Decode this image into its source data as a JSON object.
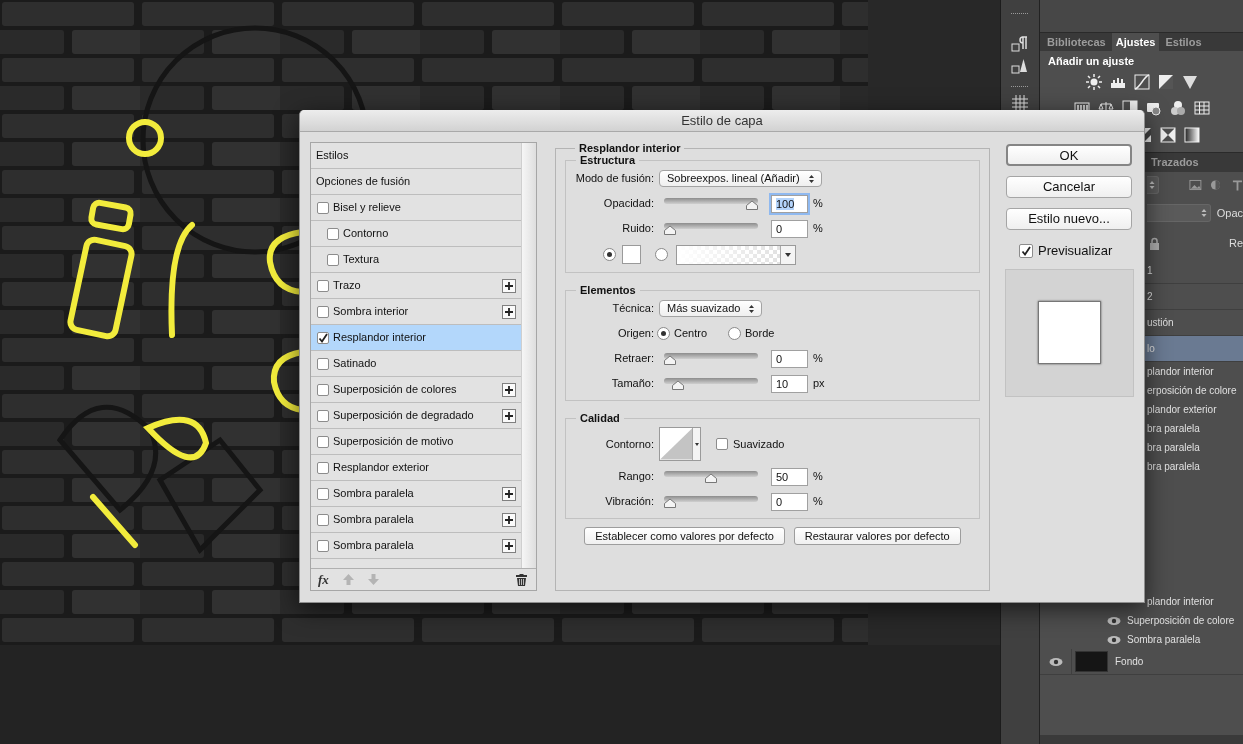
{
  "panel_tabs": [
    {
      "label": "Bibliotecas",
      "selected": false
    },
    {
      "label": "Ajustes",
      "selected": true
    },
    {
      "label": "Estilos",
      "selected": false
    }
  ],
  "adjustments": {
    "title": "Añadir un ajuste"
  },
  "layers_panel": {
    "tabs": [
      {
        "label": "Trazados",
        "selected": false
      }
    ],
    "opacity_label": "Opac",
    "fill_label": "Re",
    "rows": [
      {
        "name": "1",
        "kind": "layer-partial",
        "selected": false
      },
      {
        "name": "2",
        "kind": "layer-partial",
        "selected": false
      },
      {
        "name": "ustión",
        "kind": "layer-partial",
        "selected": false
      },
      {
        "name": "lo",
        "kind": "layer-partial",
        "selected": true
      },
      {
        "name": "plandor interior",
        "kind": "effect-partial",
        "selected": false
      },
      {
        "name": "erposición de colore",
        "kind": "effect-partial",
        "selected": false
      },
      {
        "name": "plandor exterior",
        "kind": "effect-partial",
        "selected": false
      },
      {
        "name": "bra paralela",
        "kind": "effect-partial",
        "selected": false
      },
      {
        "name": "bra paralela",
        "kind": "effect-partial",
        "selected": false
      },
      {
        "name": "bra paralela",
        "kind": "effect-partial",
        "selected": false
      }
    ],
    "lower_rows": [
      {
        "name": "plandor interior",
        "kind": "effect-partial",
        "selected": false
      },
      {
        "name": "Superposición de colore",
        "kind": "effect",
        "selected": false
      },
      {
        "name": "Sombra paralela",
        "kind": "effect",
        "selected": false
      },
      {
        "name": "Fondo",
        "kind": "layer",
        "selected": false
      }
    ]
  },
  "dialog": {
    "title": "Estilo de capa",
    "style_list": [
      {
        "label": "Estilos",
        "kind": "header",
        "selected": false
      },
      {
        "label": "Opciones de fusión",
        "kind": "header",
        "selected": false
      },
      {
        "label": "Bisel y relieve",
        "kind": "check",
        "checked": false,
        "add": false,
        "selected": false,
        "children": [
          {
            "label": "Contorno",
            "kind": "check",
            "checked": false,
            "add": false,
            "selected": false
          },
          {
            "label": "Textura",
            "kind": "check",
            "checked": false,
            "add": false,
            "selected": false
          }
        ]
      },
      {
        "label": "Trazo",
        "kind": "check",
        "checked": false,
        "add": true,
        "selected": false
      },
      {
        "label": "Sombra interior",
        "kind": "check",
        "checked": false,
        "add": true,
        "selected": false
      },
      {
        "label": "Resplandor interior",
        "kind": "check",
        "checked": true,
        "add": false,
        "selected": true
      },
      {
        "label": "Satinado",
        "kind": "check",
        "checked": false,
        "add": false,
        "selected": false
      },
      {
        "label": "Superposición de colores",
        "kind": "check",
        "checked": false,
        "add": true,
        "selected": false
      },
      {
        "label": "Superposición de degradado",
        "kind": "check",
        "checked": false,
        "add": true,
        "selected": false
      },
      {
        "label": "Superposición de motivo",
        "kind": "check",
        "checked": false,
        "add": false,
        "selected": false
      },
      {
        "label": "Resplandor exterior",
        "kind": "check",
        "checked": false,
        "add": false,
        "selected": false
      },
      {
        "label": "Sombra paralela",
        "kind": "check",
        "checked": false,
        "add": true,
        "selected": false
      },
      {
        "label": "Sombra paralela",
        "kind": "check",
        "checked": false,
        "add": true,
        "selected": false
      },
      {
        "label": "Sombra paralela",
        "kind": "check",
        "checked": false,
        "add": true,
        "selected": false
      }
    ],
    "list_footer": {
      "fx_label": "fx",
      "move_up": {
        "disabled": true
      },
      "move_down": {
        "disabled": true
      }
    },
    "section_title": "Resplandor interior",
    "groups": [
      {
        "title": "Estructura",
        "rows": [
          {
            "kind": "select",
            "label": "Modo de fusión:",
            "value": "Sobreexpos. lineal (Añadir)"
          },
          {
            "kind": "slider",
            "label": "Opacidad:",
            "level": 1,
            "value": "100",
            "unit": "%",
            "focused": true
          },
          {
            "kind": "slider",
            "label": "Ruido:",
            "level": 0,
            "value": "0",
            "unit": "%",
            "focused": false
          },
          {
            "kind": "fill",
            "options": [
              {
                "kind": "color",
                "selected": true,
                "color": "#ffffff"
              },
              {
                "kind": "gradient",
                "selected": false
              }
            ]
          }
        ]
      },
      {
        "title": "Elementos",
        "rows": [
          {
            "kind": "select",
            "label": "Técnica:",
            "value": "Más suavizado"
          },
          {
            "kind": "radio",
            "label": "Origen:",
            "options": [
              {
                "label": "Centro",
                "selected": true
              },
              {
                "label": "Borde",
                "selected": false
              }
            ]
          },
          {
            "kind": "slider",
            "label": "Retraer:",
            "level": 0,
            "value": "0",
            "unit": "%",
            "focused": false
          },
          {
            "kind": "slider",
            "label": "Tamaño:",
            "level": 0.1,
            "value": "10",
            "unit": "px",
            "focused": false
          }
        ]
      },
      {
        "title": "Calidad",
        "rows": [
          {
            "kind": "contour",
            "label": "Contorno:",
            "checkbox": {
              "label": "Suavizado",
              "checked": false
            }
          },
          {
            "kind": "slider",
            "label": "Rango:",
            "level": 0.5,
            "value": "50",
            "unit": "%",
            "focused": false
          },
          {
            "kind": "slider",
            "label": "Vibración:",
            "level": 0,
            "value": "0",
            "unit": "%",
            "focused": false
          }
        ]
      }
    ],
    "default_buttons": [
      "Establecer como valores por defecto",
      "Restaurar valores por defecto"
    ],
    "actions": [
      {
        "label": "OK",
        "default": true
      },
      {
        "label": "Cancelar",
        "default": false
      },
      {
        "label": "Estilo nuevo...",
        "default": false
      }
    ],
    "preview": {
      "label": "Previsualizar",
      "checked": true
    }
  }
}
